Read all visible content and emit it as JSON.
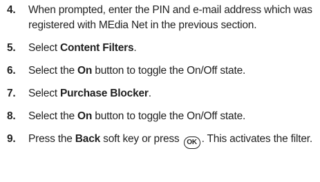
{
  "steps": [
    {
      "number": "4.",
      "text": "When prompted, enter the PIN and e-mail address which was registered with MEdia Net in the previous section."
    },
    {
      "number": "5.",
      "before": "Select ",
      "bold": "Content Filters",
      "after": "."
    },
    {
      "number": "6.",
      "before": "Select the ",
      "bold": "On",
      "after": " button to toggle the On/Off state."
    },
    {
      "number": "7.",
      "before": "Select ",
      "bold": "Purchase Blocker",
      "after": "."
    },
    {
      "number": "8.",
      "before": "Select the ",
      "bold": "On",
      "after": " button to toggle the On/Off state."
    },
    {
      "number": "9.",
      "before": "Press the ",
      "bold": "Back",
      "middle": " soft key or press ",
      "key_label": "OK",
      "key_icon": "ok-key-icon",
      "after": ". This activates the filter."
    }
  ]
}
